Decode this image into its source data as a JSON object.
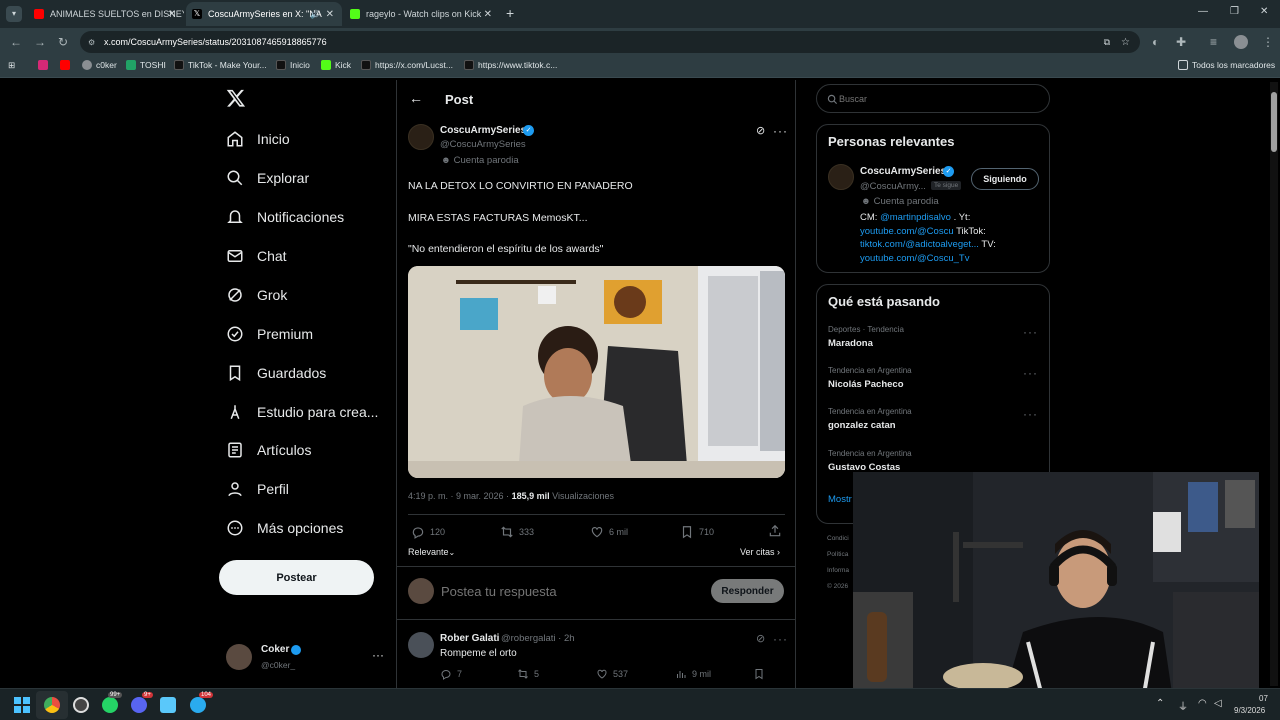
{
  "browser": {
    "tabs": [
      {
        "title": "ANIMALES SUELTOS en DISNEY"
      },
      {
        "title": "CoscuArmySeries en X: \"NA"
      },
      {
        "title": "rageylo - Watch clips on Kick"
      }
    ],
    "url": "x.com/CoscuArmySeries/status/2031087465918865776",
    "bookmarks": [
      "c0ker",
      "TOSHI",
      "TikTok - Make Your...",
      "Inicio",
      "Kick",
      "https://x.com/Lucst...",
      "https://www.tiktok.c..."
    ],
    "all_bookmarks": "Todos los marcadores"
  },
  "nav": {
    "items": [
      "Inicio",
      "Explorar",
      "Notificaciones",
      "Chat",
      "Grok",
      "Premium",
      "Guardados",
      "Estudio para crea...",
      "Artículos",
      "Perfil",
      "Más opciones"
    ],
    "post_button": "Postear",
    "account": {
      "name": "Coker",
      "handle": "@c0ker_"
    }
  },
  "post": {
    "header": "Post",
    "author_name": "CoscuArmySeries",
    "author_handle": "@CoscuArmySeries",
    "parody_label": "Cuenta parodia",
    "lines": [
      "NA LA DETOX LO CONVIRTIO EN PANADERO",
      "MIRA ESTAS FACTURAS MemosKT...",
      "\"No entendieron el espíritu de los awards\""
    ],
    "time": "4:19 p. m. · 9 mar. 2026 ·",
    "views_count": "185,9 mil",
    "views_label": "Visualizaciones",
    "stats": {
      "replies": "120",
      "reposts": "333",
      "likes": "6 mil",
      "bookmarks": "710"
    },
    "sort_label": "Relevante",
    "quotes_label": "Ver citas",
    "reply_placeholder": "Postea tu respuesta",
    "reply_button": "Responder"
  },
  "reply": {
    "name": "Rober Galati",
    "handle": "@robergalati · 2h",
    "text": "Rompeme el orto",
    "stats": {
      "replies": "7",
      "reposts": "5",
      "likes": "537",
      "views": "9 mil"
    }
  },
  "sidebar": {
    "search_placeholder": "Buscar",
    "relevant_title": "Personas relevantes",
    "person": {
      "name": "CoscuArmySeries",
      "handle": "@CoscuArmy...",
      "follows_you": "Te sigue",
      "button": "Siguiendo",
      "parody": "Cuenta parodia",
      "bio_cm": "CM:",
      "bio_cm_link": "@martinpdisalvo",
      "bio_yt": ". Yt:",
      "bio_yt_link": "youtube.com/@Coscu",
      "bio_tt": "TikTok:",
      "bio_tt_link": "tiktok.com/@adictoalveget...",
      "bio_tv": "TV:",
      "bio_tv_link": "youtube.com/@Coscu_Tv"
    },
    "trends_title": "Qué está pasando",
    "trends": [
      {
        "category": "Deportes · Tendencia",
        "name": "Maradona"
      },
      {
        "category": "Tendencia en Argentina",
        "name": "Nicolás Pacheco"
      },
      {
        "category": "Tendencia en Argentina",
        "name": "gonzalez catan"
      },
      {
        "category": "Tendencia en Argentina",
        "name": "Gustavo Costas"
      }
    ],
    "show_more": "Mostr",
    "footer": [
      "Condici",
      "Política",
      "Informa",
      "© 2026"
    ]
  },
  "taskbar": {
    "date": "9/3/2026",
    "time_partial": "07",
    "badges": [
      "99+",
      "9+",
      "104"
    ]
  },
  "colors": {
    "accent": "#1d9bf0",
    "bg": "#000000",
    "border": "#2f3336",
    "chrome": "#2e3d42"
  }
}
